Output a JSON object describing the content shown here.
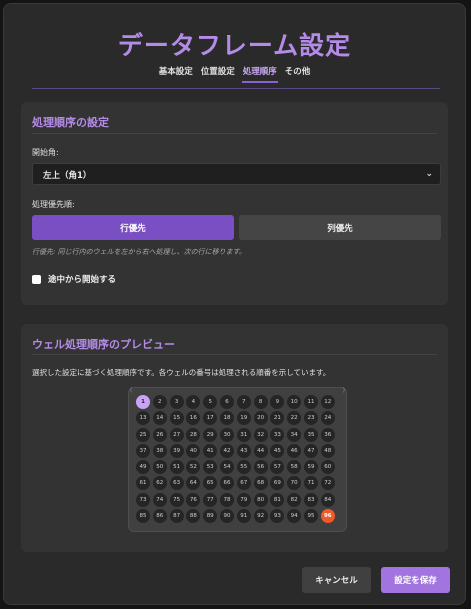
{
  "title": "データフレーム設定",
  "tabs": [
    {
      "label": "基本設定",
      "active": false
    },
    {
      "label": "位置設定",
      "active": false
    },
    {
      "label": "処理順序",
      "active": true
    },
    {
      "label": "その他",
      "active": false
    }
  ],
  "order_section": {
    "title": "処理順序の設定",
    "start_corner_label": "開始角:",
    "start_corner_value": "左上（角1）",
    "priority_label": "処理優先順:",
    "row_first": "行優先",
    "column_first": "列優先",
    "selected": "行優先",
    "hint": "行優先: 同じ行内のウェルを左から右へ処理し、次の行に移ります。",
    "resume_label": "途中から開始する",
    "resume_checked": false
  },
  "preview_section": {
    "title": "ウェル処理順序のプレビュー",
    "description": "選択した設定に基づく処理順序です。各ウェルの番号は処理される順番を示しています。",
    "rows": 8,
    "columns": 12,
    "wells": [
      1,
      2,
      3,
      4,
      5,
      6,
      7,
      8,
      9,
      10,
      11,
      12,
      13,
      14,
      15,
      16,
      17,
      18,
      19,
      20,
      21,
      22,
      23,
      24,
      25,
      26,
      27,
      28,
      29,
      30,
      31,
      32,
      33,
      34,
      35,
      36,
      37,
      38,
      39,
      40,
      41,
      42,
      43,
      44,
      45,
      46,
      47,
      48,
      49,
      50,
      51,
      52,
      53,
      54,
      55,
      56,
      57,
      58,
      59,
      60,
      61,
      62,
      63,
      64,
      65,
      66,
      67,
      68,
      69,
      70,
      71,
      72,
      73,
      74,
      75,
      76,
      77,
      78,
      79,
      80,
      81,
      82,
      83,
      84,
      85,
      86,
      87,
      88,
      89,
      90,
      91,
      92,
      93,
      94,
      95,
      96
    ],
    "first_color": "#c9a4f6",
    "last_color": "#f05a28"
  },
  "footer": {
    "cancel_label": "キャンセル",
    "save_label": "設定を保存"
  },
  "colors": {
    "accent": "#b48ce8",
    "primary_button": "#a274e0",
    "toggle_active": "#7a4fc4"
  }
}
